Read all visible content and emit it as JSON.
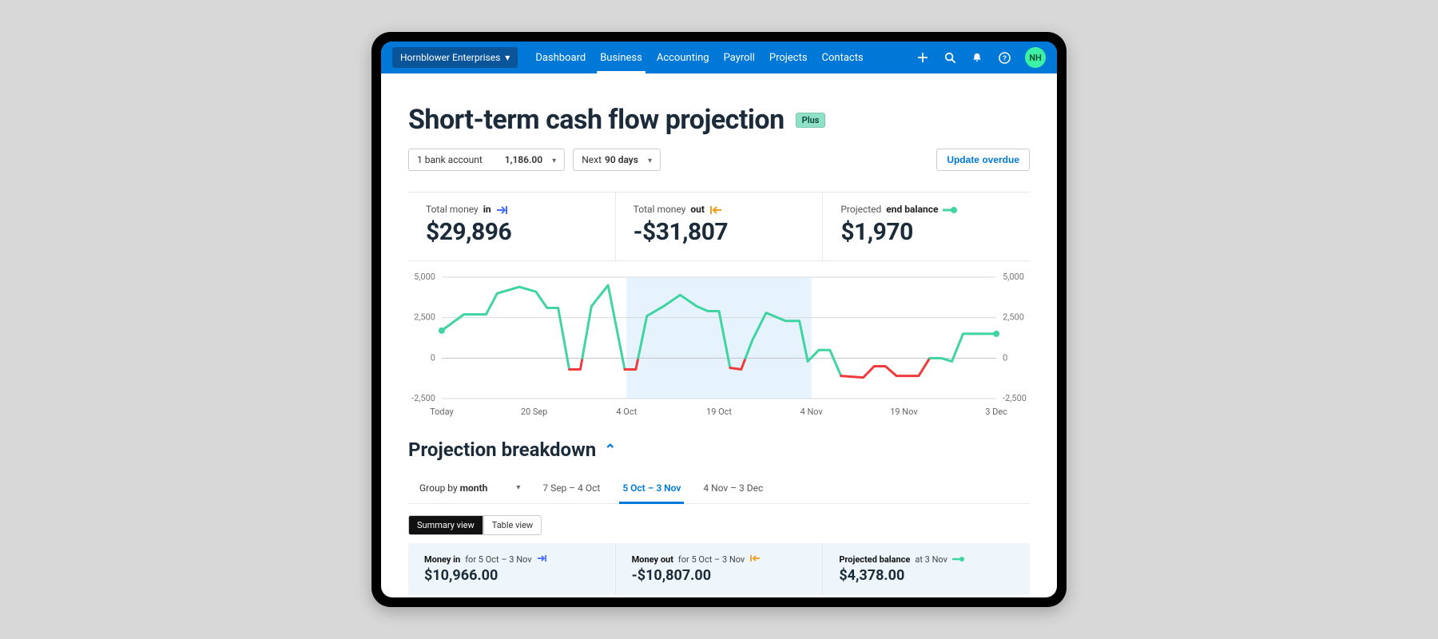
{
  "nav": {
    "org": "Hornblower Enterprises",
    "links": [
      "Dashboard",
      "Business",
      "Accounting",
      "Payroll",
      "Projects",
      "Contacts"
    ],
    "active_index": 1,
    "avatar_initials": "NH"
  },
  "page": {
    "title": "Short-term cash flow projection",
    "badge": "Plus"
  },
  "controls": {
    "account_label": "1 bank account",
    "account_value": "1,186.00",
    "range_prefix": "Next",
    "range_value": "90 days",
    "update_btn": "Update overdue"
  },
  "summary": {
    "in": {
      "label_pre": "Total money ",
      "label_bold": "in",
      "value": "$29,896"
    },
    "out": {
      "label_pre": "Total money ",
      "label_bold": "out",
      "value": "-$31,807"
    },
    "bal": {
      "label_pre": "Projected ",
      "label_bold": "end balance",
      "value": "$1,970"
    }
  },
  "chart_data": {
    "type": "line",
    "ylabel": "",
    "ylim": [
      -2500,
      5000
    ],
    "yticks": [
      5000,
      2500,
      0,
      -2500
    ],
    "ytick_labels": [
      "5,000",
      "2,500",
      "0",
      "-2,500"
    ],
    "x_labels": [
      "Today",
      "20 Sep",
      "4 Oct",
      "19 Oct",
      "4 Nov",
      "19 Nov",
      "3 Dec"
    ],
    "highlight_range_index": [
      2,
      4
    ],
    "series": [
      {
        "name": "Projected balance",
        "points": [
          {
            "x": 0.0,
            "y": 1700
          },
          {
            "x": 0.04,
            "y": 2700
          },
          {
            "x": 0.08,
            "y": 2700
          },
          {
            "x": 0.1,
            "y": 4000
          },
          {
            "x": 0.14,
            "y": 4400
          },
          {
            "x": 0.17,
            "y": 4100
          },
          {
            "x": 0.19,
            "y": 3100
          },
          {
            "x": 0.21,
            "y": 3100
          },
          {
            "x": 0.23,
            "y": -700
          },
          {
            "x": 0.25,
            "y": -700
          },
          {
            "x": 0.27,
            "y": 3200
          },
          {
            "x": 0.3,
            "y": 4500
          },
          {
            "x": 0.33,
            "y": -700
          },
          {
            "x": 0.35,
            "y": -700
          },
          {
            "x": 0.37,
            "y": 2600
          },
          {
            "x": 0.4,
            "y": 3200
          },
          {
            "x": 0.43,
            "y": 3900
          },
          {
            "x": 0.46,
            "y": 3200
          },
          {
            "x": 0.48,
            "y": 2900
          },
          {
            "x": 0.5,
            "y": 2900
          },
          {
            "x": 0.52,
            "y": -600
          },
          {
            "x": 0.54,
            "y": -700
          },
          {
            "x": 0.56,
            "y": 1100
          },
          {
            "x": 0.585,
            "y": 2800
          },
          {
            "x": 0.62,
            "y": 2300
          },
          {
            "x": 0.645,
            "y": 2300
          },
          {
            "x": 0.66,
            "y": -200
          },
          {
            "x": 0.68,
            "y": 500
          },
          {
            "x": 0.7,
            "y": 500
          },
          {
            "x": 0.72,
            "y": -1100
          },
          {
            "x": 0.76,
            "y": -1200
          },
          {
            "x": 0.78,
            "y": -500
          },
          {
            "x": 0.8,
            "y": -500
          },
          {
            "x": 0.82,
            "y": -1100
          },
          {
            "x": 0.86,
            "y": -1100
          },
          {
            "x": 0.88,
            "y": 0
          },
          {
            "x": 0.9,
            "y": 0
          },
          {
            "x": 0.92,
            "y": -200
          },
          {
            "x": 0.94,
            "y": 1500
          },
          {
            "x": 1.0,
            "y": 1500
          }
        ]
      }
    ],
    "colors": {
      "positive": "#3fd4a0",
      "negative": "#ef3b3b"
    }
  },
  "breakdown": {
    "title": "Projection breakdown",
    "group_by_prefix": "Group by ",
    "group_by_value": "month",
    "period_tabs": [
      "7 Sep – 4 Oct",
      "5 Oct – 3 Nov",
      "4 Nov – 3 Dec"
    ],
    "period_active_index": 1,
    "view_summary": "Summary view",
    "view_table": "Table view",
    "cards": {
      "in": {
        "bold": "Money in",
        "rest": " for 5 Oct – 3 Nov",
        "value": "$10,966.00"
      },
      "out": {
        "bold": "Money out",
        "rest": " for 5 Oct – 3 Nov",
        "value": "-$10,807.00"
      },
      "bal": {
        "bold": "Projected balance",
        "rest": " at 3 Nov",
        "value": "$4,378.00"
      }
    }
  }
}
